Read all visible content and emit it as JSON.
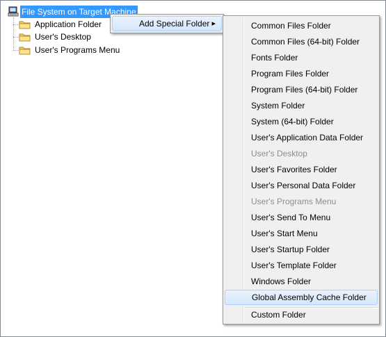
{
  "tree": {
    "root": "File System on Target Machine",
    "items": [
      "Application Folder",
      "User's Desktop",
      "User's Programs Menu"
    ]
  },
  "context_menu": {
    "add_special_folder": "Add Special Folder",
    "arrow": "▸"
  },
  "submenu": {
    "items": [
      {
        "label": "Common Files Folder",
        "disabled": false
      },
      {
        "label": "Common Files (64-bit) Folder",
        "disabled": false
      },
      {
        "label": "Fonts Folder",
        "disabled": false
      },
      {
        "label": "Program Files Folder",
        "disabled": false
      },
      {
        "label": "Program Files (64-bit) Folder",
        "disabled": false
      },
      {
        "label": "System Folder",
        "disabled": false
      },
      {
        "label": "System (64-bit) Folder",
        "disabled": false
      },
      {
        "label": "User's Application Data Folder",
        "disabled": false
      },
      {
        "label": "User's Desktop",
        "disabled": true
      },
      {
        "label": "User's Favorites Folder",
        "disabled": false
      },
      {
        "label": "User's Personal Data Folder",
        "disabled": false
      },
      {
        "label": "User's Programs Menu",
        "disabled": true
      },
      {
        "label": "User's Send To Menu",
        "disabled": false
      },
      {
        "label": "User's Start Menu",
        "disabled": false
      },
      {
        "label": "User's Startup Folder",
        "disabled": false
      },
      {
        "label": "User's Template Folder",
        "disabled": false
      },
      {
        "label": "Windows Folder",
        "disabled": false
      },
      {
        "label": "Global Assembly Cache Folder",
        "disabled": false,
        "highlighted": true
      }
    ],
    "after_separator": {
      "label": "Custom Folder",
      "disabled": false
    }
  }
}
